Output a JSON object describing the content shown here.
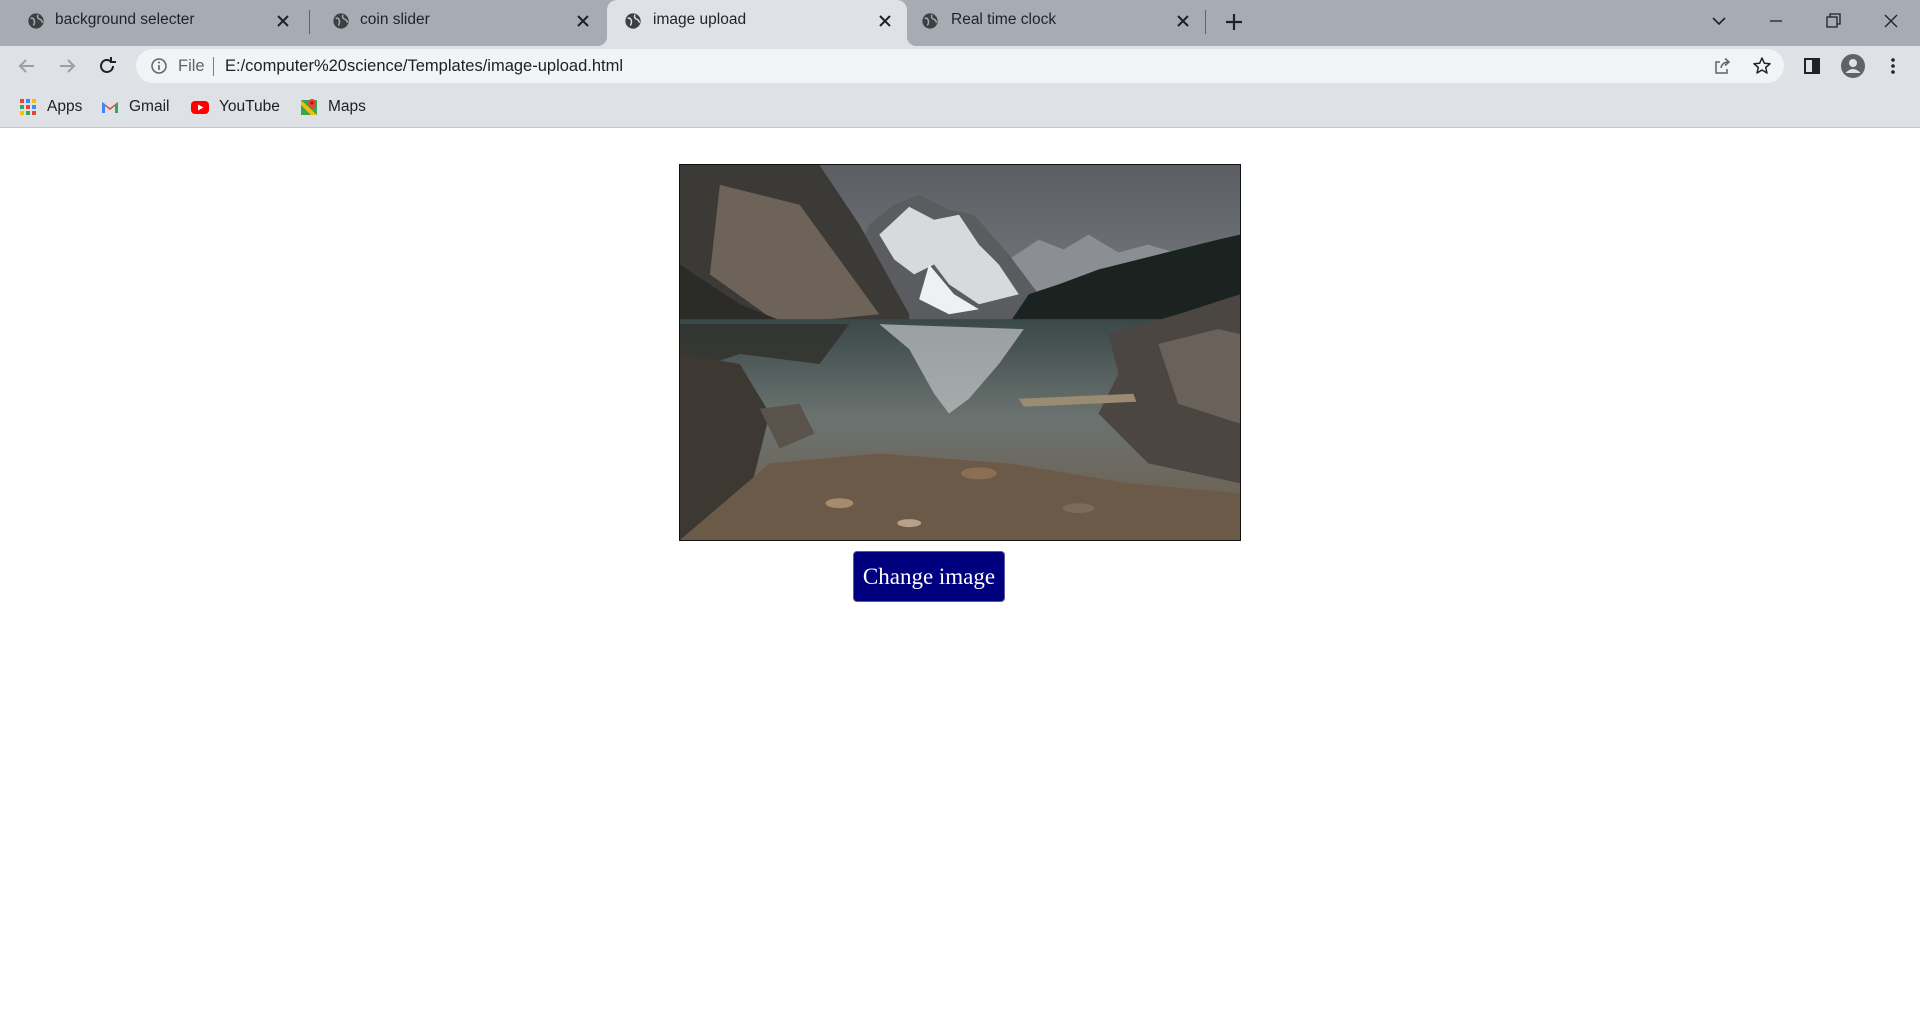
{
  "browser": {
    "tabs": [
      {
        "title": "background selecter",
        "active": false,
        "icon": "globe-icon"
      },
      {
        "title": "coin slider",
        "active": false,
        "icon": "globe-icon"
      },
      {
        "title": "image upload",
        "active": true,
        "icon": "globe-icon"
      },
      {
        "title": "Real time clock",
        "active": false,
        "icon": "globe-icon"
      }
    ],
    "address": {
      "scheme_label": "File",
      "url": "E:/computer%20science/Templates/image-upload.html"
    },
    "bookmarks": [
      {
        "label": "Apps",
        "icon": "apps-grid-icon"
      },
      {
        "label": "Gmail",
        "icon": "gmail-icon"
      },
      {
        "label": "YouTube",
        "icon": "youtube-icon"
      },
      {
        "label": "Maps",
        "icon": "maps-icon"
      }
    ],
    "colors": {
      "tabstrip": "#a7acb4",
      "toolbar": "#dee1e6",
      "omnibox": "#f1f3f4"
    }
  },
  "page": {
    "image_alt": "Mountain lake landscape",
    "change_button_label": "Change image",
    "button_color": "#00007f"
  }
}
